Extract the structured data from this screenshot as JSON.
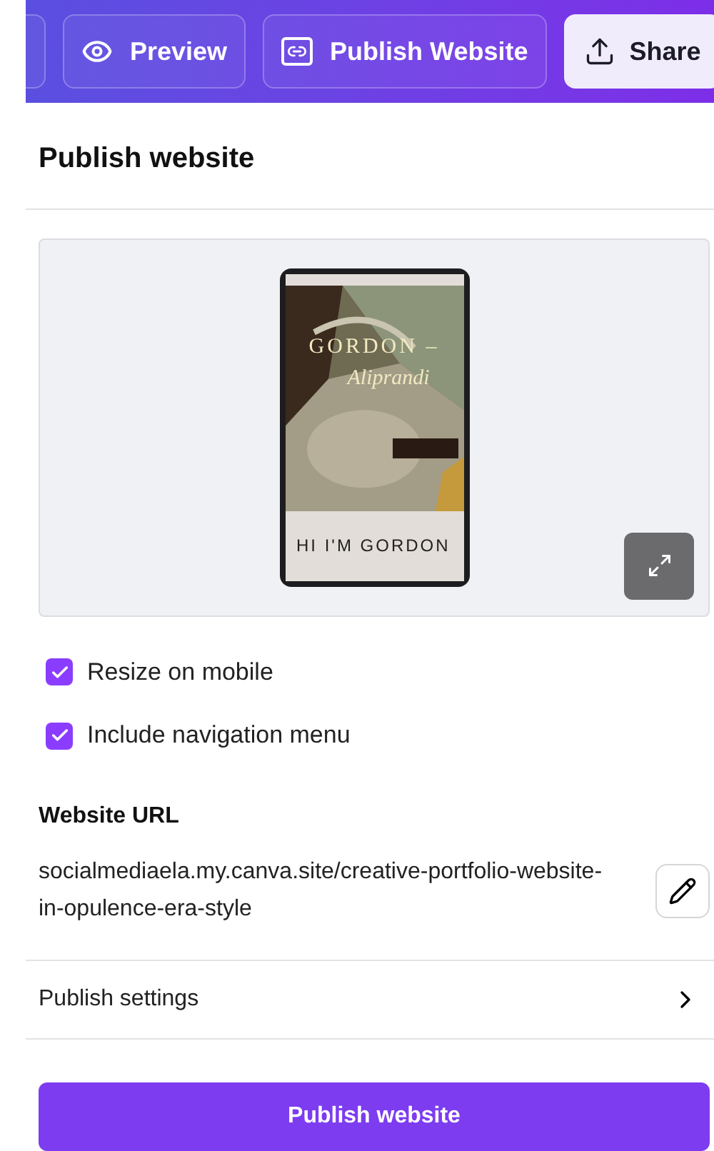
{
  "toolbar": {
    "buttons": [
      {
        "label": "Preview",
        "kind": "preview"
      },
      {
        "label": "Publish Website",
        "kind": "publish"
      },
      {
        "label": "Share",
        "kind": "share"
      }
    ]
  },
  "panel": {
    "title": "Publish website",
    "preview": {
      "headline": "GORDON –",
      "script": "Aliprandi",
      "greeting": "HI I'M GORDON"
    },
    "options": [
      {
        "label": "Resize on mobile",
        "checked": true
      },
      {
        "label": "Include navigation menu",
        "checked": true
      }
    ],
    "url_label": "Website URL",
    "url": "socialmediaela.my.canva.site/creative-portfolio-website-in-opulence-era-style",
    "settings_label": "Publish settings",
    "publish_button": "Publish website"
  }
}
